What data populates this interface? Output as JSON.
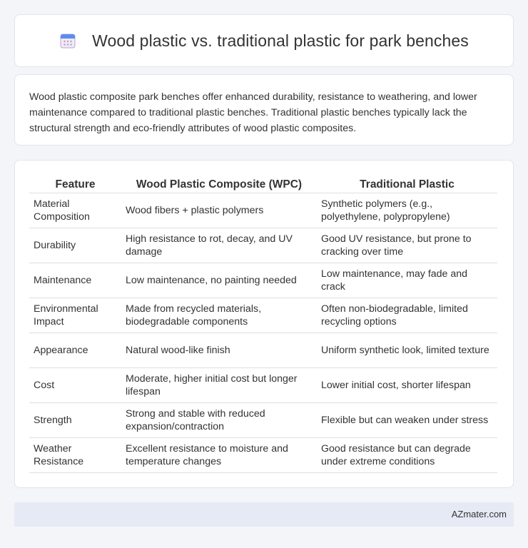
{
  "header": {
    "title": "Wood plastic vs. traditional plastic for park benches",
    "icon": "calendar-icon"
  },
  "intro": {
    "text": "Wood plastic composite park benches offer enhanced durability, resistance to weathering, and lower maintenance compared to traditional plastic benches. Traditional plastic benches typically lack the structural strength and eco-friendly attributes of wood plastic composites."
  },
  "table": {
    "headers": [
      "Feature",
      "Wood Plastic Composite (WPC)",
      "Traditional Plastic"
    ],
    "rows": [
      [
        "Material Composition",
        "Wood fibers + plastic polymers",
        "Synthetic polymers (e.g., polyethylene, polypropylene)"
      ],
      [
        "Durability",
        "High resistance to rot, decay, and UV damage",
        "Good UV resistance, but prone to cracking over time"
      ],
      [
        "Maintenance",
        "Low maintenance, no painting needed",
        "Low maintenance, may fade and crack"
      ],
      [
        "Environmental Impact",
        "Made from recycled materials, biodegradable components",
        "Often non-biodegradable, limited recycling options"
      ],
      [
        "Appearance",
        "Natural wood-like finish",
        "Uniform synthetic look, limited texture"
      ],
      [
        "Cost",
        "Moderate, higher initial cost but longer lifespan",
        "Lower initial cost, shorter lifespan"
      ],
      [
        "Strength",
        "Strong and stable with reduced expansion/contraction",
        "Flexible but can weaken under stress"
      ],
      [
        "Weather Resistance",
        "Excellent resistance to moisture and temperature changes",
        "Good resistance but can degrade under extreme conditions"
      ]
    ]
  },
  "footer": {
    "brand": "AZmater.com"
  }
}
